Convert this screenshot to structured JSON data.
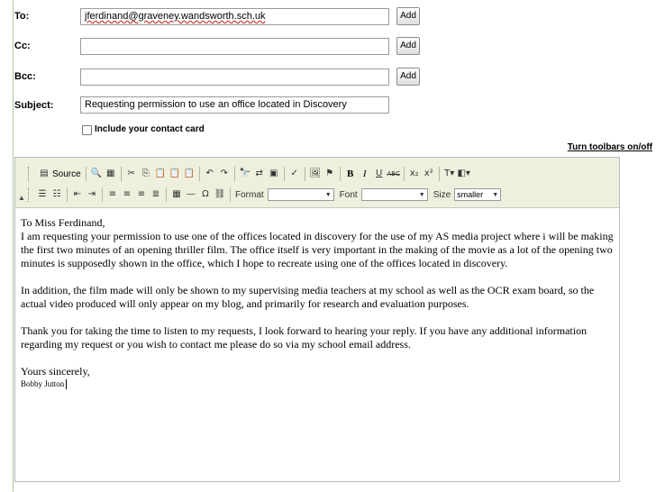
{
  "to": {
    "label": "To:",
    "value": "jferdinand@graveney.wandsworth.sch.uk",
    "add": "Add"
  },
  "cc": {
    "label": "Cc:",
    "value": "",
    "add": "Add"
  },
  "bcc": {
    "label": "Bcc:",
    "value": "",
    "add": "Add"
  },
  "subject": {
    "label": "Subject:",
    "value": "Requesting permission to use an office located in Discovery"
  },
  "contact_card": {
    "label": "Include your contact card",
    "checked": false
  },
  "toolbar_toggle": "Turn toolbars on/off",
  "toolbar": {
    "source_label": "Source",
    "format_label": "Format",
    "format_value": "",
    "font_label": "Font",
    "font_value": "",
    "size_label": "Size",
    "size_value": "smaller"
  },
  "body": {
    "greeting": "To Miss Ferdinand,",
    "para1": "I am requesting your permission to use one of the offices located in discovery for the use of my AS media project where i will be making the first two minutes of an opening thriller film. The office itself is very important in the making of the movie as a lot of the opening two minutes is supposedly shown in the office, which I hope to recreate using one of the offices located in discovery.",
    "para2": "In addition, the film made will only be shown to my supervising media teachers at my school as well as the OCR exam board, so the actual video produced will only appear on my blog, and primarily for research and evaluation purposes.",
    "para3": "Thank you for taking the time to listen to my requests, I look forward to hearing your reply. If you have any additional information regarding my request or you wish to contact me please do so via my school email address.",
    "closing": "Yours sincerely,",
    "signature": "Bobby Jutton"
  }
}
